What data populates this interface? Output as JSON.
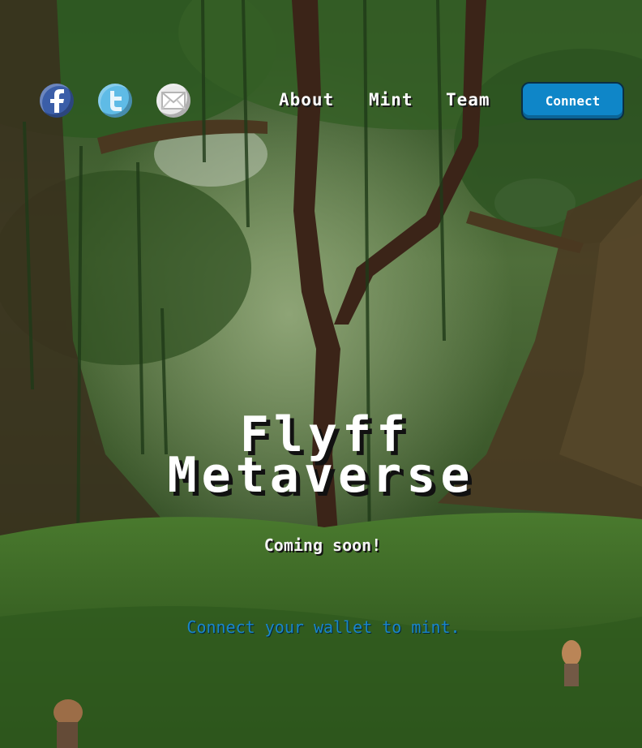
{
  "social": {
    "facebook_icon": "facebook-icon",
    "twitter_icon": "twitter-icon",
    "mail_icon": "mail-icon"
  },
  "nav": {
    "links": [
      "About",
      "Mint",
      "Team"
    ],
    "connect_label": "Connect"
  },
  "hero": {
    "title_line1": "Flyff",
    "title_line2": "Metaverse",
    "subtitle": "Coming soon!",
    "wallet_message": "Connect your wallet to mint."
  },
  "colors": {
    "accent": "#0f86c8",
    "link_text": "#1a86c8",
    "facebook": "#3b5ea8",
    "twitter": "#5fbbe6"
  }
}
